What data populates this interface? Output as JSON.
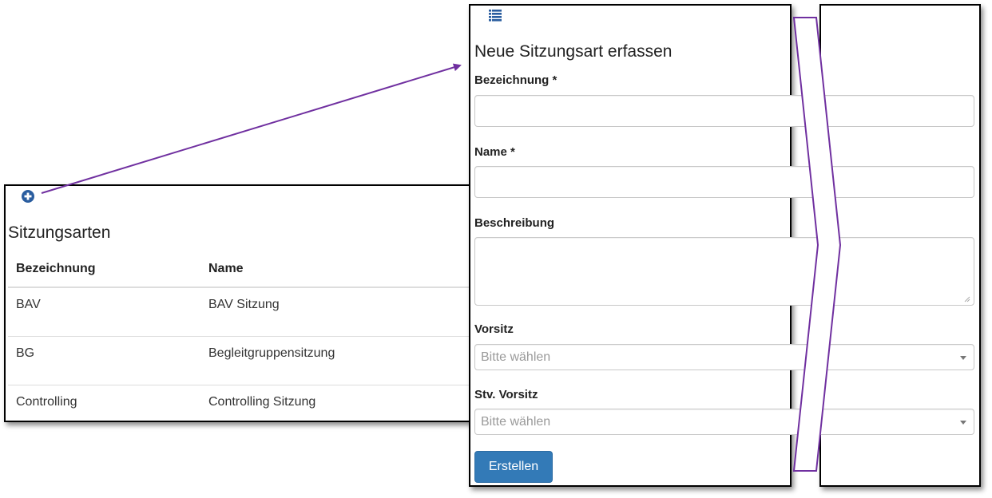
{
  "list_panel": {
    "title": "Sitzungsarten",
    "add_icon": "plus-circle-icon",
    "columns": [
      "Bezeichnung",
      "Name"
    ],
    "rows": [
      {
        "bezeichnung": "BAV",
        "name": "BAV Sitzung"
      },
      {
        "bezeichnung": "BG",
        "name": "Begleitgruppensitzung"
      },
      {
        "bezeichnung": "Controlling",
        "name": "Controlling Sitzung"
      }
    ]
  },
  "form_panel": {
    "list_icon": "list-icon",
    "title": "Neue Sitzungsart erfassen",
    "fields": {
      "bezeichnung": {
        "label": "Bezeichnung *",
        "value": ""
      },
      "name": {
        "label": "Name *",
        "value": ""
      },
      "beschreibung": {
        "label": "Beschreibung",
        "value": ""
      },
      "vorsitz": {
        "label": "Vorsitz",
        "placeholder": "Bitte wählen"
      },
      "stv_vorsitz": {
        "label": "Stv. Vorsitz",
        "placeholder": "Bitte wählen"
      }
    },
    "submit_label": "Erstellen"
  },
  "colors": {
    "accent_blue": "#337ab7",
    "icon_blue": "#2a5d9f",
    "annotation_purple": "#7030a0"
  }
}
